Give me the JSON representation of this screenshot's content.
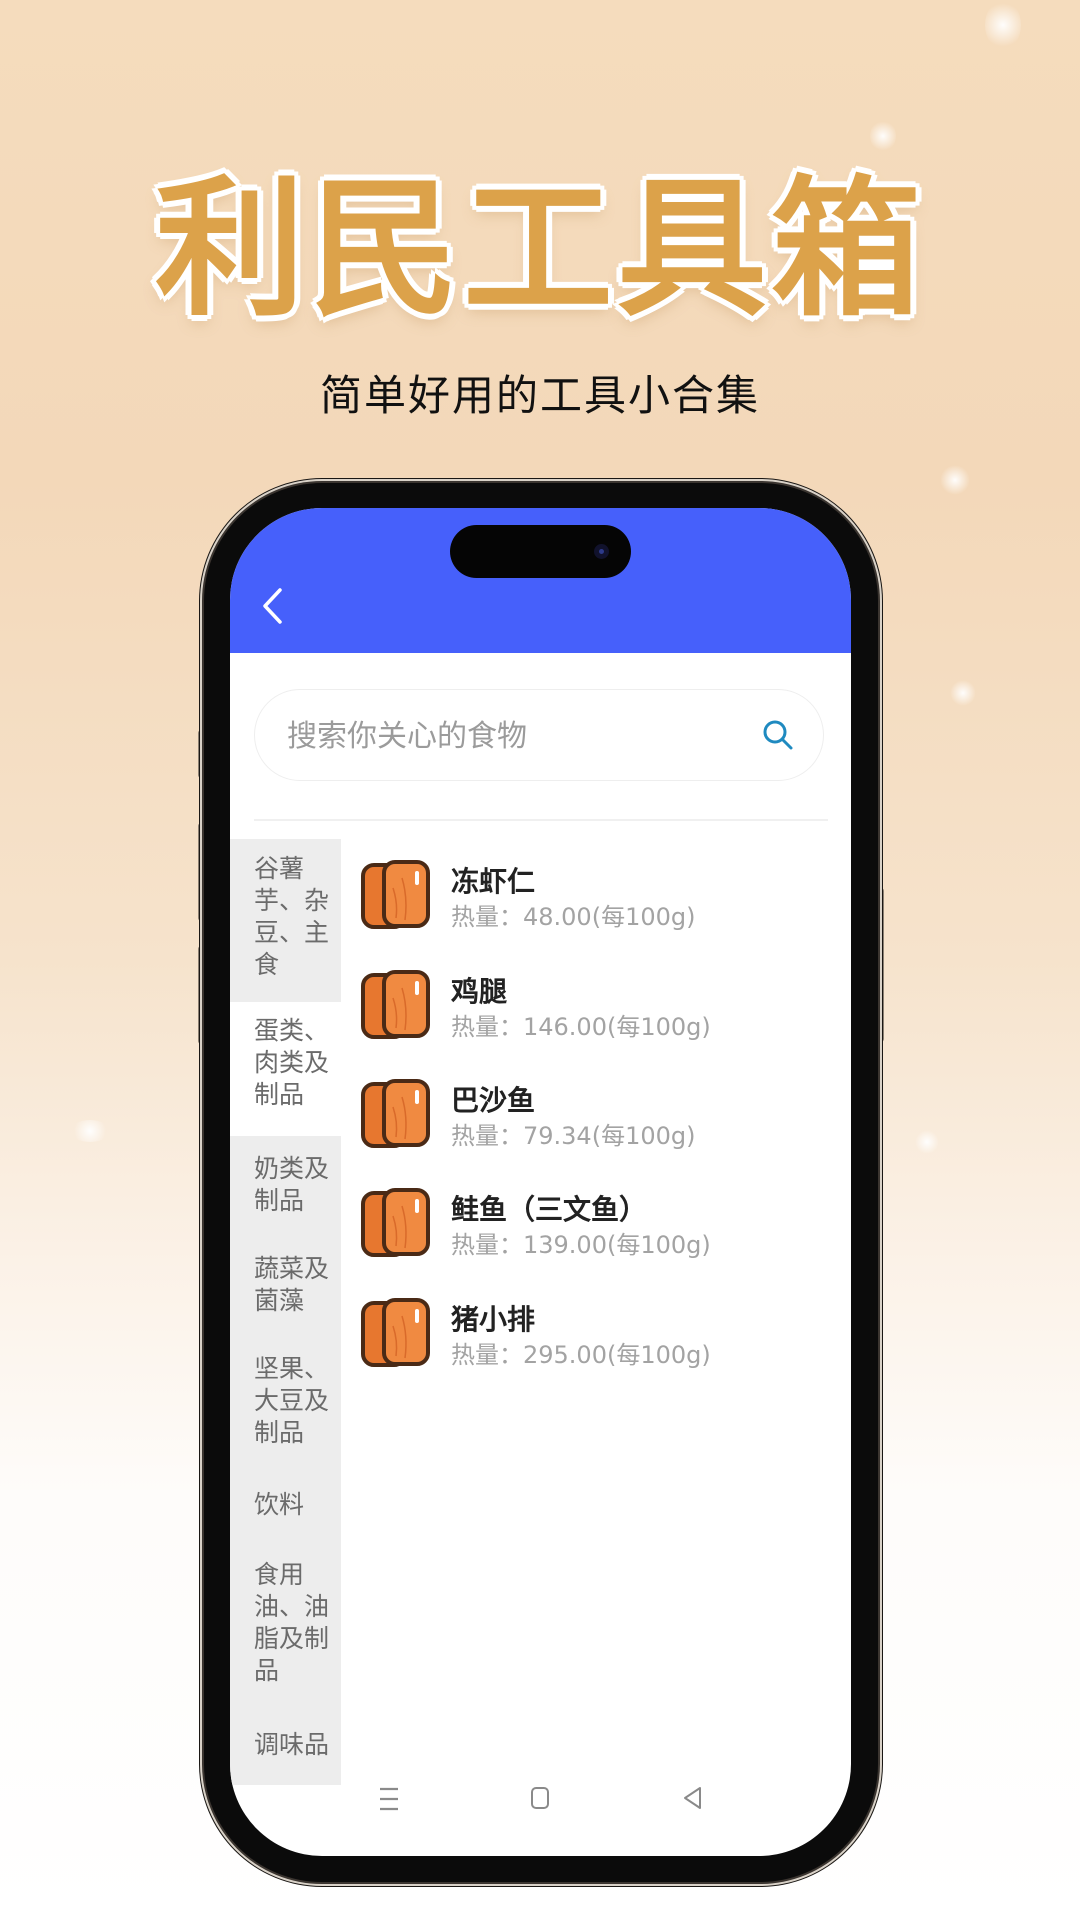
{
  "hero": {
    "title": "利民工具箱",
    "subtitle": "简单好用的工具小合集",
    "title_color": "#dca24a"
  },
  "app": {
    "header_color": "#4660fb",
    "back_icon": "chevron-left-icon",
    "search": {
      "placeholder": "搜索你关心的食物",
      "value": "",
      "icon": "search-icon",
      "icon_color": "#1f8ac0"
    },
    "categories": [
      {
        "label": "谷薯芋、杂豆、主食",
        "selected": false
      },
      {
        "label": "蛋类、肉类及制品",
        "selected": true
      },
      {
        "label": "奶类及制品",
        "selected": false
      },
      {
        "label": "蔬菜及菌藻",
        "selected": false
      },
      {
        "label": "坚果、大豆及制品",
        "selected": false
      },
      {
        "label": "饮料",
        "selected": false
      },
      {
        "label": "食用油、油脂及制品",
        "selected": false
      },
      {
        "label": "调味品",
        "selected": false
      }
    ],
    "foods": [
      {
        "name": "冻虾仁",
        "calories": "热量：48.00(每100g)"
      },
      {
        "name": "鸡腿",
        "calories": "热量：146.00(每100g)"
      },
      {
        "name": "巴沙鱼",
        "calories": "热量：79.34(每100g)"
      },
      {
        "name": "鲑鱼（三文鱼）",
        "calories": "热量：139.00(每100g)"
      },
      {
        "name": "猪小排",
        "calories": "热量：295.00(每100g)"
      }
    ],
    "nav": {
      "recents_icon": "menu-lines-icon",
      "home_icon": "home-square-icon",
      "back_icon": "back-triangle-icon"
    }
  }
}
